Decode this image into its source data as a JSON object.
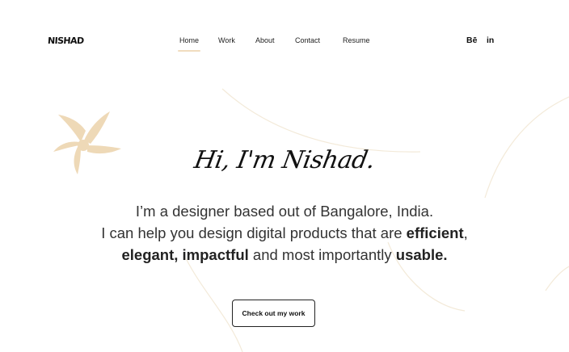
{
  "brand": {
    "logo_text": "NISHAD"
  },
  "nav": {
    "items": [
      {
        "label": "Home",
        "active": true
      },
      {
        "label": "Work",
        "active": false
      },
      {
        "label": "About",
        "active": false
      },
      {
        "label": "Contact",
        "active": false
      },
      {
        "label": "Resume",
        "active": false
      }
    ]
  },
  "social": {
    "behance_label": "Bē",
    "linkedin_label": "in",
    "behance_icon": "behance-icon",
    "linkedin_icon": "linkedin-icon"
  },
  "hero": {
    "title": "Hi, I'm Nishad.",
    "line1": "I’m a designer based out of Bangalore, India.",
    "line2_start": "I can help you design digital products that are ",
    "line2_bold": "efficient",
    "line2_end": ",",
    "line3_bold1": "elegant, impactful",
    "line3_mid": " and most importantly ",
    "line3_bold2": "usable.",
    "cta_label": "Check out my work"
  },
  "colors": {
    "accent": "#f1dcbf",
    "text": "#222222",
    "decor_lines": "#f3ead9"
  }
}
